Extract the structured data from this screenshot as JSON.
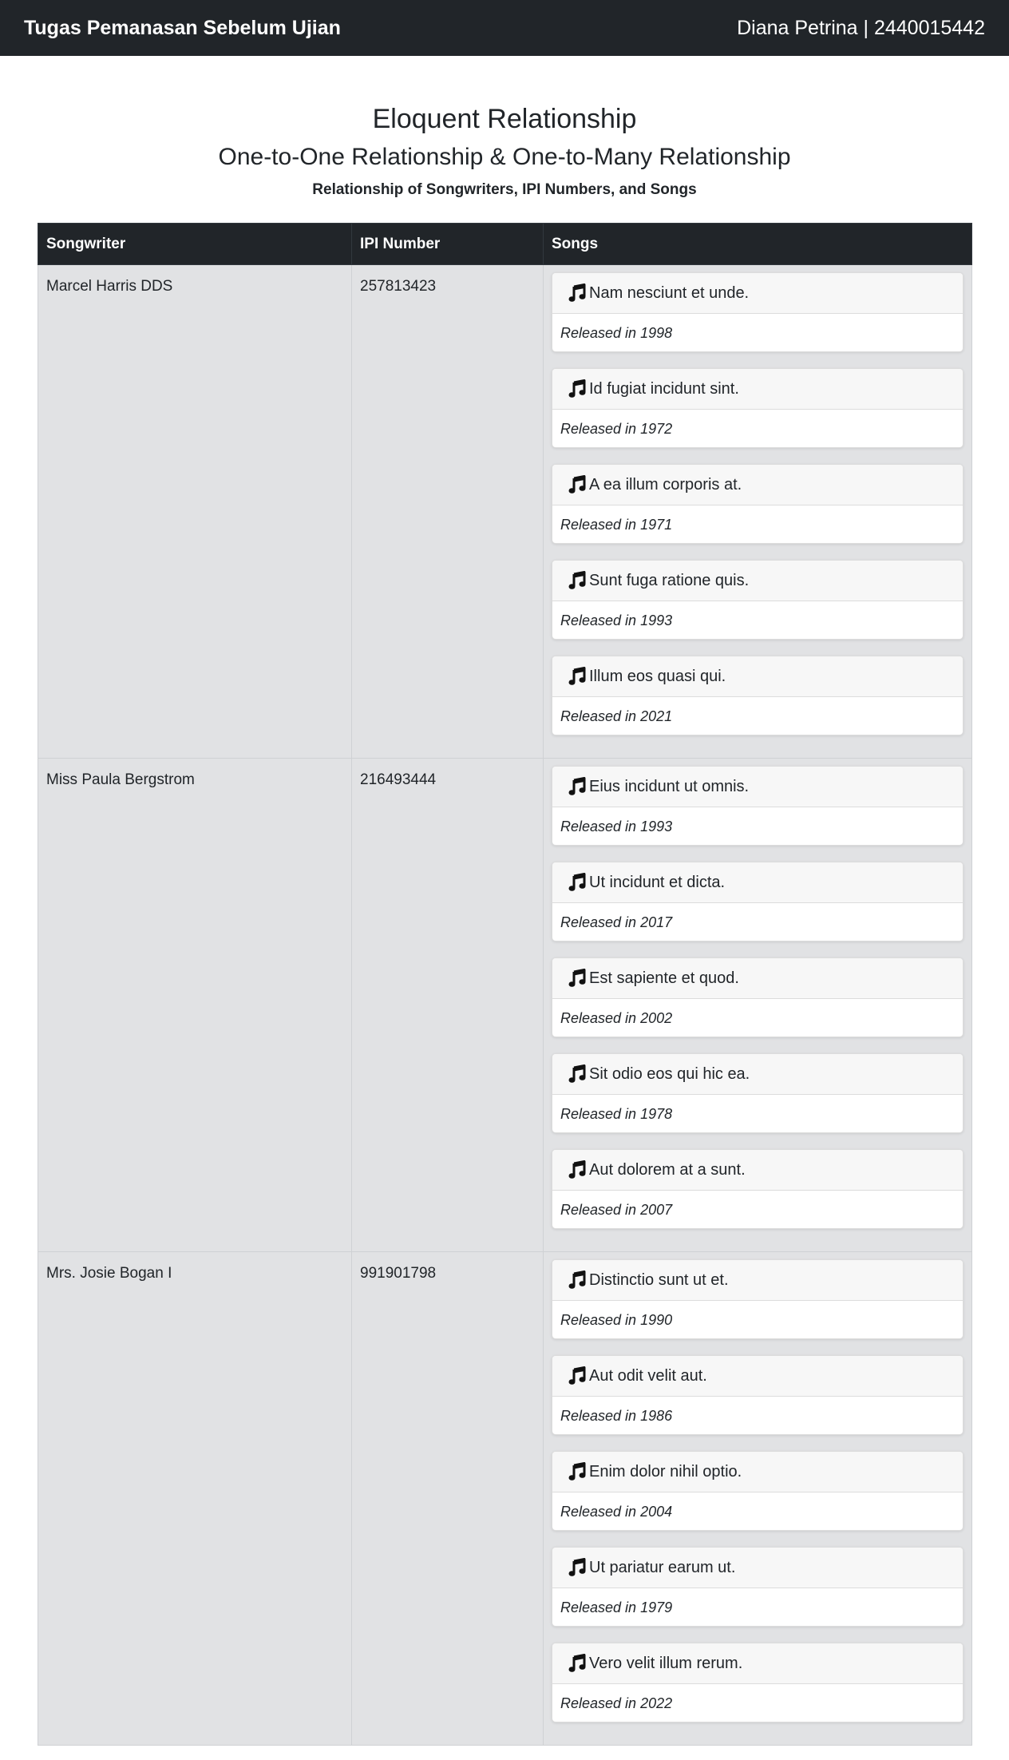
{
  "navbar": {
    "brand": "Tugas Pemanasan Sebelum Ujian",
    "user": "Diana Petrina | 2440015442"
  },
  "headings": {
    "title": "Eloquent Relationship",
    "subtitle": "One-to-One Relationship & One-to-Many Relationship",
    "description": "Relationship of Songwriters, IPI Numbers, and Songs"
  },
  "table": {
    "columns": [
      "Songwriter",
      "IPI Number",
      "Songs"
    ],
    "rows": [
      {
        "songwriter": "Marcel Harris DDS",
        "ipi": "257813423",
        "songs": [
          {
            "title": "Nam nesciunt et unde.",
            "released": "Released in 1998"
          },
          {
            "title": "Id fugiat incidunt sint.",
            "released": "Released in 1972"
          },
          {
            "title": "A ea illum corporis at.",
            "released": "Released in 1971"
          },
          {
            "title": "Sunt fuga ratione quis.",
            "released": "Released in 1993"
          },
          {
            "title": "Illum eos quasi qui.",
            "released": "Released in 2021"
          }
        ]
      },
      {
        "songwriter": "Miss Paula Bergstrom",
        "ipi": "216493444",
        "songs": [
          {
            "title": "Eius incidunt ut omnis.",
            "released": "Released in 1993"
          },
          {
            "title": "Ut incidunt et dicta.",
            "released": "Released in 2017"
          },
          {
            "title": "Est sapiente et quod.",
            "released": "Released in 2002"
          },
          {
            "title": "Sit odio eos qui hic ea.",
            "released": "Released in 1978"
          },
          {
            "title": "Aut dolorem at a sunt.",
            "released": "Released in 2007"
          }
        ]
      },
      {
        "songwriter": "Mrs. Josie Bogan I",
        "ipi": "991901798",
        "songs": [
          {
            "title": "Distinctio sunt ut et.",
            "released": "Released in 1990"
          },
          {
            "title": "Aut odit velit aut.",
            "released": "Released in 1986"
          },
          {
            "title": "Enim dolor nihil optio.",
            "released": "Released in 2004"
          },
          {
            "title": "Ut pariatur earum ut.",
            "released": "Released in 1979"
          },
          {
            "title": "Vero velit illum rerum.",
            "released": "Released in 2022"
          }
        ]
      }
    ]
  },
  "icons": {
    "song": "music-note-icon"
  }
}
